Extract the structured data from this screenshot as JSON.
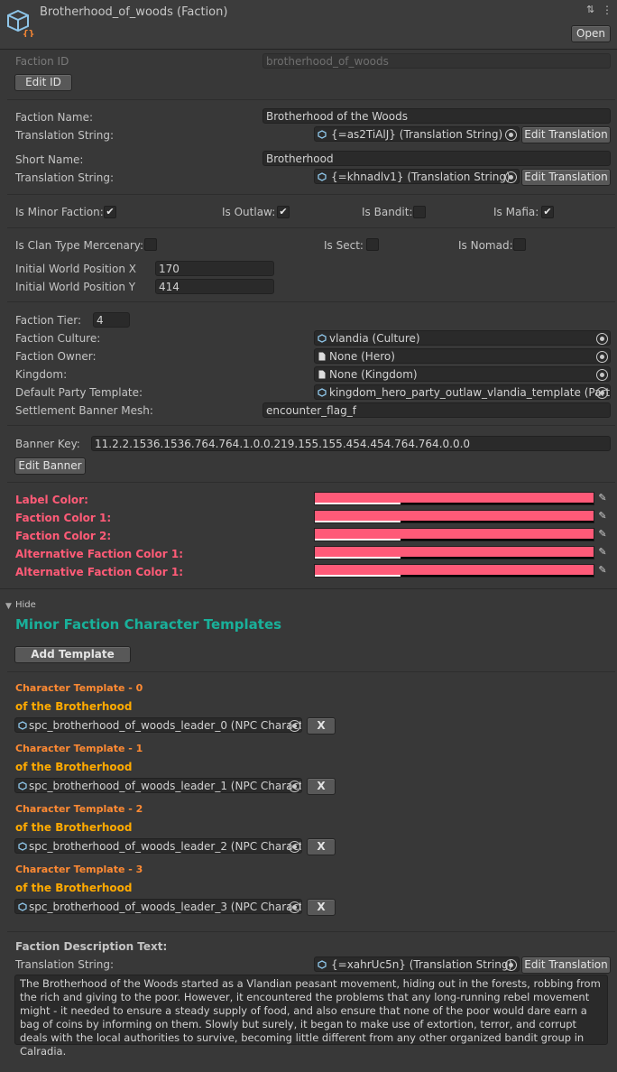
{
  "header": {
    "title": "Brotherhood_of_woods (Faction)",
    "open_label": "Open",
    "icon": "prefab-cube-icon",
    "menu_icon": "kebab-menu-icon"
  },
  "identity": {
    "faction_id_label": "Faction ID",
    "faction_id_value": "brotherhood_of_woods",
    "edit_id_label": "Edit ID"
  },
  "names": {
    "faction_name_label": "Faction Name:",
    "faction_name_value": "Brotherhood of the Woods",
    "translation_label": "Translation String:",
    "faction_name_translation": "{=as2TiAlJ} (Translation String)",
    "edit_translation_label": "Edit Translation",
    "short_name_label": "Short Name:",
    "short_name_value": "Brotherhood",
    "short_name_translation": "{=khnadlv1} (Translation String)"
  },
  "flags": {
    "is_minor_faction_label": "Is Minor Faction:",
    "is_minor_faction": true,
    "is_outlaw_label": "Is Outlaw:",
    "is_outlaw": true,
    "is_bandit_label": "Is Bandit:",
    "is_bandit": false,
    "is_mafia_label": "Is Mafia:",
    "is_mafia": true,
    "is_mercenary_label": "Is Clan Type Mercenary:",
    "is_mercenary": false,
    "is_sect_label": "Is Sect:",
    "is_sect": false,
    "is_nomad_label": "Is Nomad:",
    "is_nomad": false
  },
  "position": {
    "x_label": "Initial World Position X",
    "x_value": "170",
    "y_label": "Initial World Position Y",
    "y_value": "414"
  },
  "details": {
    "tier_label": "Faction Tier:",
    "tier_value": "4",
    "culture_label": "Faction Culture:",
    "culture_value": "vlandia (Culture)",
    "owner_label": "Faction Owner:",
    "owner_value": "None (Hero)",
    "kingdom_label": "Kingdom:",
    "kingdom_value": "None (Kingdom)",
    "party_template_label": "Default Party Template:",
    "party_template_value": "kingdom_hero_party_outlaw_vlandia_template (Party",
    "banner_mesh_label": "Settlement Banner Mesh:",
    "banner_mesh_value": "encounter_flag_f"
  },
  "banner": {
    "key_label": "Banner Key:",
    "key_value": "11.2.2.1536.1536.764.764.1.0.0.219.155.155.454.454.764.764.0.0.0",
    "edit_banner_label": "Edit Banner"
  },
  "colors": {
    "swatch": "#ff5a78",
    "items": [
      {
        "label": "Label Color:"
      },
      {
        "label": "Faction Color 1:"
      },
      {
        "label": "Faction Color 2:"
      },
      {
        "label": "Alternative Faction Color 1:"
      },
      {
        "label": "Alternative Faction Color 1:"
      }
    ]
  },
  "templates": {
    "hide_label": "Hide",
    "heading": "Minor Faction Character Templates",
    "add_label": "Add Template",
    "remove_label": "X",
    "items": [
      {
        "title": "Character Template - 0",
        "subtitle": "of the Brotherhood",
        "value": "spc_brotherhood_of_woods_leader_0 (NPC Charact"
      },
      {
        "title": "Character Template - 1",
        "subtitle": "of the Brotherhood",
        "value": "spc_brotherhood_of_woods_leader_1 (NPC Charact"
      },
      {
        "title": "Character Template - 2",
        "subtitle": "of the Brotherhood",
        "value": "spc_brotherhood_of_woods_leader_2 (NPC Charact"
      },
      {
        "title": "Character Template - 3",
        "subtitle": "of the Brotherhood",
        "value": "spc_brotherhood_of_woods_leader_3 (NPC Charact"
      }
    ]
  },
  "description": {
    "heading": "Faction Description Text:",
    "translation_label": "Translation String:",
    "translation_value": "{=xahrUc5n} (Translation String)",
    "edit_translation_label": "Edit Translation",
    "text": "The Brotherhood of the Woods started as a Vlandian peasant movement, hiding out in the forests, robbing from the rich and giving to the poor. However, it encountered the problems that any long-running rebel movement might - it needed to ensure a steady supply of food, and also ensure that none of the poor would dare earn a bag of coins by informing on them. Slowly but surely, it began to make use of extortion, terror, and corrupt deals with the local authorities to survive, becoming little different from any other organized bandit group in Calradia."
  }
}
